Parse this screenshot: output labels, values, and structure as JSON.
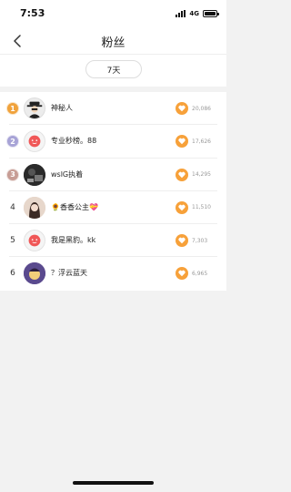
{
  "status_bar": {
    "time": "7:53",
    "network": "4G"
  },
  "nav": {
    "title": "粉丝"
  },
  "filter": {
    "label": "7天"
  },
  "colors": {
    "accent": "#f7a13a",
    "rank1": "#f0a23b",
    "rank2": "#a7a3d6",
    "rank3": "#c79d95"
  },
  "fans": [
    {
      "rank": "1",
      "name": "神秘人",
      "score": "20,086",
      "avatar_icon": "mystery-person-icon"
    },
    {
      "rank": "2",
      "name": "专业秒榜。88",
      "score": "17,626",
      "avatar_icon": "red-face-icon"
    },
    {
      "rank": "3",
      "name": "wslG执着",
      "score": "14,295",
      "avatar_icon": "photo-avatar-icon"
    },
    {
      "rank": "4",
      "name": "🌻香香公主💝",
      "score": "11,510",
      "avatar_icon": "photo-avatar-icon"
    },
    {
      "rank": "5",
      "name": "我是黑豹。kk",
      "score": "7,303",
      "avatar_icon": "red-face-icon"
    },
    {
      "rank": "6",
      "name": "？浮云蓝天",
      "score": "6,965",
      "avatar_icon": "photo-avatar-icon"
    }
  ]
}
